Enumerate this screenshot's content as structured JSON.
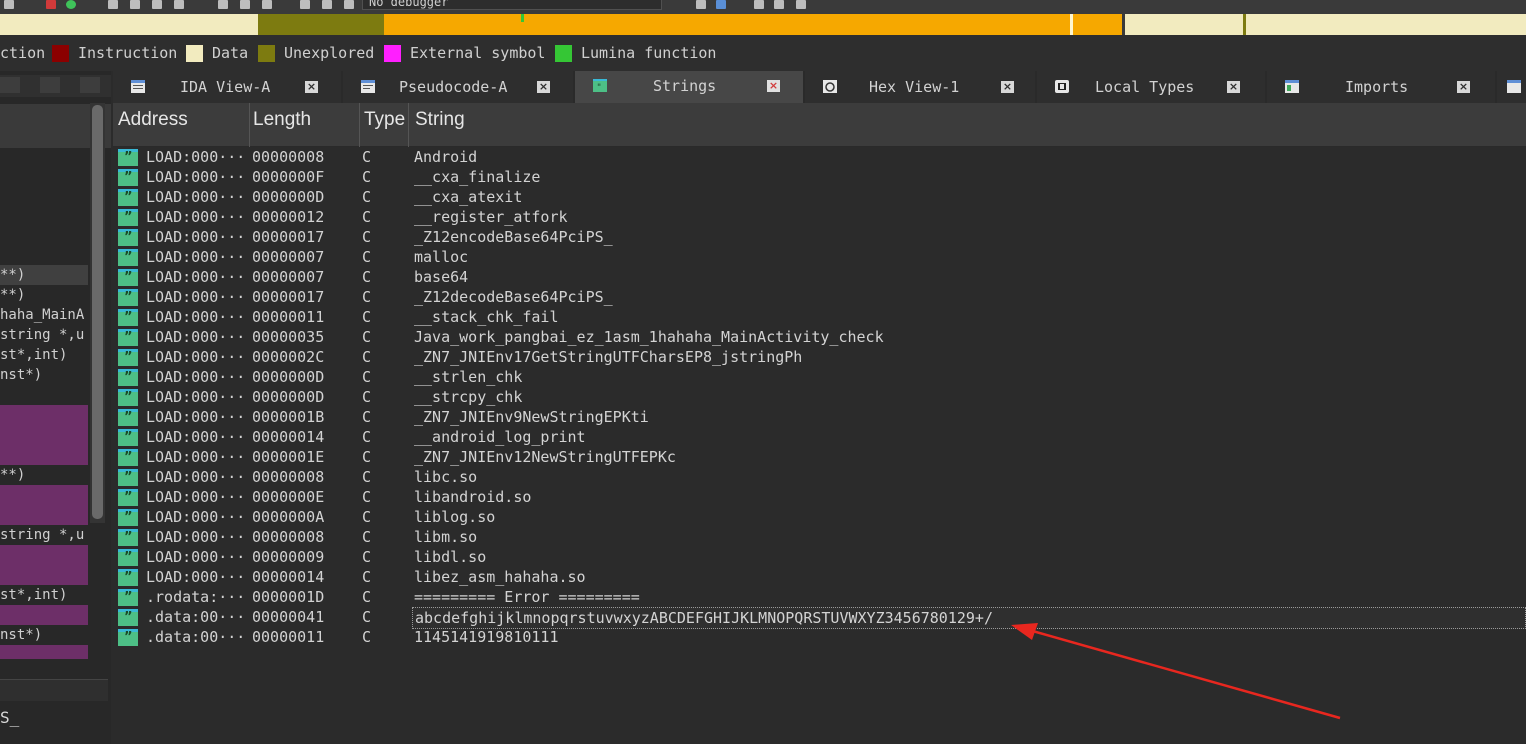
{
  "toolbar": {
    "debugger_label": "No debugger"
  },
  "legend": [
    {
      "label": "Instruction",
      "color": "#8b0000"
    },
    {
      "label": "Data",
      "color": "#f2ebbf"
    },
    {
      "label": "Unexplored",
      "color": "#7d7b10"
    },
    {
      "label": "External symbol",
      "color": "#ff1fff"
    },
    {
      "label": "Lumina function",
      "color": "#35c635"
    }
  ],
  "legend_partial": "ction",
  "left_panel": {
    "rows": [
      "**)",
      "**)",
      "haha_MainA",
      "string *,u",
      "st*,int)",
      "nst*)",
      "**)",
      "string *,u",
      "st*,int)",
      "nst*)"
    ],
    "bottom_label": "S_"
  },
  "tabs": [
    {
      "label": "IDA View-A",
      "icon": "ida-view-icon",
      "active": false
    },
    {
      "label": "Pseudocode-A",
      "icon": "pseudocode-icon",
      "active": false
    },
    {
      "label": "Strings",
      "icon": "strings-icon",
      "active": true
    },
    {
      "label": "Hex View-1",
      "icon": "hex-view-icon",
      "active": false
    },
    {
      "label": "Local Types",
      "icon": "local-types-icon",
      "active": false
    },
    {
      "label": "Imports",
      "icon": "imports-icon",
      "active": false
    }
  ],
  "table": {
    "headers": {
      "address": "Address",
      "length": "Length",
      "type": "Type",
      "string": "String"
    },
    "rows": [
      {
        "address": "LOAD:000···",
        "length": "00000008",
        "type": "C",
        "string": "Android"
      },
      {
        "address": "LOAD:000···",
        "length": "0000000F",
        "type": "C",
        "string": "__cxa_finalize"
      },
      {
        "address": "LOAD:000···",
        "length": "0000000D",
        "type": "C",
        "string": "__cxa_atexit"
      },
      {
        "address": "LOAD:000···",
        "length": "00000012",
        "type": "C",
        "string": "__register_atfork"
      },
      {
        "address": "LOAD:000···",
        "length": "00000017",
        "type": "C",
        "string": "_Z12encodeBase64PciPS_"
      },
      {
        "address": "LOAD:000···",
        "length": "00000007",
        "type": "C",
        "string": "malloc"
      },
      {
        "address": "LOAD:000···",
        "length": "00000007",
        "type": "C",
        "string": "base64"
      },
      {
        "address": "LOAD:000···",
        "length": "00000017",
        "type": "C",
        "string": "_Z12decodeBase64PciPS_"
      },
      {
        "address": "LOAD:000···",
        "length": "00000011",
        "type": "C",
        "string": "__stack_chk_fail"
      },
      {
        "address": "LOAD:000···",
        "length": "00000035",
        "type": "C",
        "string": "Java_work_pangbai_ez_1asm_1hahaha_MainActivity_check"
      },
      {
        "address": "LOAD:000···",
        "length": "0000002C",
        "type": "C",
        "string": "_ZN7_JNIEnv17GetStringUTFCharsEP8_jstringPh"
      },
      {
        "address": "LOAD:000···",
        "length": "0000000D",
        "type": "C",
        "string": "__strlen_chk"
      },
      {
        "address": "LOAD:000···",
        "length": "0000000D",
        "type": "C",
        "string": "__strcpy_chk"
      },
      {
        "address": "LOAD:000···",
        "length": "0000001B",
        "type": "C",
        "string": "_ZN7_JNIEnv9NewStringEPKti"
      },
      {
        "address": "LOAD:000···",
        "length": "00000014",
        "type": "C",
        "string": "__android_log_print"
      },
      {
        "address": "LOAD:000···",
        "length": "0000001E",
        "type": "C",
        "string": "_ZN7_JNIEnv12NewStringUTFEPKc"
      },
      {
        "address": "LOAD:000···",
        "length": "00000008",
        "type": "C",
        "string": "libc.so"
      },
      {
        "address": "LOAD:000···",
        "length": "0000000E",
        "type": "C",
        "string": "libandroid.so"
      },
      {
        "address": "LOAD:000···",
        "length": "0000000A",
        "type": "C",
        "string": "liblog.so"
      },
      {
        "address": "LOAD:000···",
        "length": "00000008",
        "type": "C",
        "string": "libm.so"
      },
      {
        "address": "LOAD:000···",
        "length": "00000009",
        "type": "C",
        "string": "libdl.so"
      },
      {
        "address": "LOAD:000···",
        "length": "00000014",
        "type": "C",
        "string": "libez_asm_hahaha.so"
      },
      {
        "address": ".rodata:···",
        "length": "0000001D",
        "type": "C",
        "string": "========= Error ========="
      },
      {
        "address": ".data:00···",
        "length": "00000041",
        "type": "C",
        "string": "abcdefghijklmnopqrstuvwxyzABCDEFGHIJKLMNOPQRSTUVWXYZ3456780129+/",
        "selected": true
      },
      {
        "address": ".data:00···",
        "length": "00000011",
        "type": "C",
        "string": "1145141919810111"
      }
    ]
  },
  "annotation": {
    "arrow_color": "#e8271f"
  }
}
